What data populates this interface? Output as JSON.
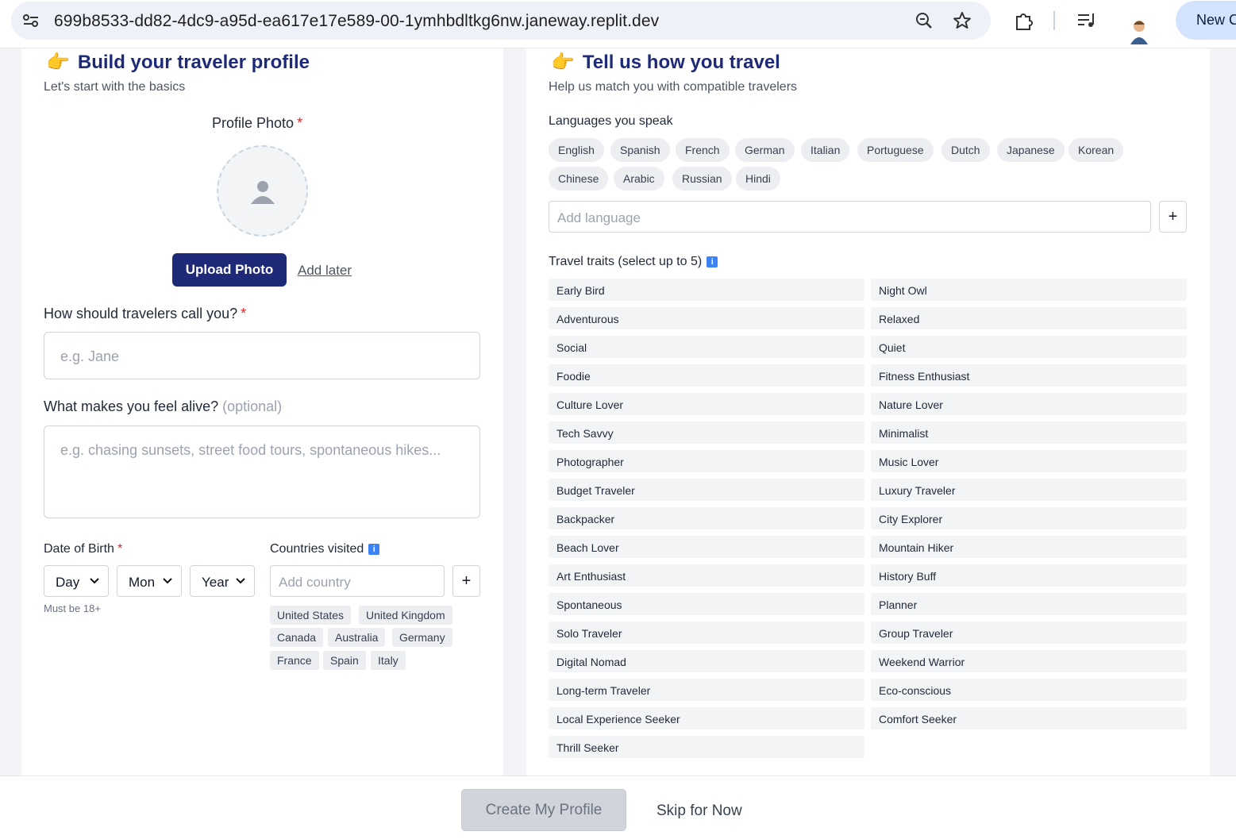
{
  "browser": {
    "url": "699b8533-dd82-4dc9-a95d-ea617e17e589-00-1ymhbdltkg6nw.janeway.replit.dev",
    "new_chat_label": "New C"
  },
  "left": {
    "title": "Build your traveler profile",
    "subtitle": "Let's start with the basics",
    "profile_photo_label": "Profile Photo",
    "required_mark": "*",
    "upload_label": "Upload Photo",
    "add_later_label": "Add later",
    "name_label": "How should travelers call you?",
    "name_placeholder": "e.g. Jane",
    "alive_label": "What makes you feel alive?",
    "alive_optional": "(optional)",
    "alive_placeholder": "e.g. chasing sunsets, street food tours, spontaneous hikes...",
    "dob_label": "Date of Birth",
    "day_value": "Day",
    "month_value": "Mon",
    "year_value": "Year",
    "dob_hint": "Must be 18+",
    "countries_label": "Countries visited",
    "country_placeholder": "Add country",
    "plus": "+",
    "countries": [
      "United States",
      "United Kingdom",
      "Canada",
      "Australia",
      "Germany",
      "France",
      "Spain",
      "Italy"
    ]
  },
  "right": {
    "title": "Tell us how you travel",
    "subtitle": "Help us match you with compatible travelers",
    "languages_label": "Languages you speak",
    "languages": [
      "English",
      "Spanish",
      "French",
      "German",
      "Italian",
      "Portuguese",
      "Dutch",
      "Japanese",
      "Korean",
      "Chinese",
      "Arabic",
      "Russian",
      "Hindi"
    ],
    "language_placeholder": "Add language",
    "plus": "+",
    "traits_label": "Travel traits (select up to 5)",
    "traits": [
      "Early Bird",
      "Night Owl",
      "Adventurous",
      "Relaxed",
      "Social",
      "Quiet",
      "Foodie",
      "Fitness Enthusiast",
      "Culture Lover",
      "Nature Lover",
      "Tech Savvy",
      "Minimalist",
      "Photographer",
      "Music Lover",
      "Budget Traveler",
      "Luxury Traveler",
      "Backpacker",
      "City Explorer",
      "Beach Lover",
      "Mountain Hiker",
      "Art Enthusiast",
      "History Buff",
      "Spontaneous",
      "Planner",
      "Solo Traveler",
      "Group Traveler",
      "Digital Nomad",
      "Weekend Warrior",
      "Long-term Traveler",
      "Eco-conscious",
      "Local Experience Seeker",
      "Comfort Seeker",
      "Thrill Seeker"
    ]
  },
  "footer": {
    "create_label": "Create My Profile",
    "skip_label": "Skip for Now"
  },
  "icons": {
    "hand": "pointing-hand-emoji",
    "info": "info-icon"
  },
  "colors": {
    "brand": "#1e2a78",
    "required": "#dc2626",
    "info": "#3b82f6"
  }
}
